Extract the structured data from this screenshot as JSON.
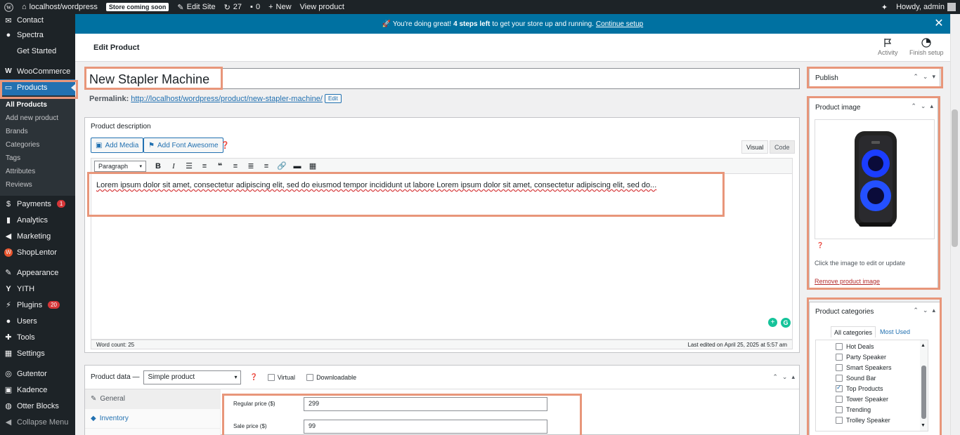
{
  "adminbar": {
    "site": "localhost/wordpress",
    "store_badge": "Store coming soon",
    "edit_site": "Edit Site",
    "updates": "27",
    "comments": "0",
    "new": "New",
    "view_product": "View product",
    "howdy": "Howdy, admin"
  },
  "sidebar": {
    "items_top": [
      {
        "label": "Contact",
        "icon": "envelope-icon"
      },
      {
        "label": "Spectra",
        "icon": "spectra-icon"
      },
      {
        "label": "Get Started",
        "icon": ""
      }
    ],
    "woocommerce": "WooCommerce",
    "products": "Products",
    "submenu": [
      "All Products",
      "Add new product",
      "Brands",
      "Categories",
      "Tags",
      "Attributes",
      "Reviews"
    ],
    "items_bottom": [
      {
        "label": "Payments",
        "icon": "payments-icon",
        "count": "1"
      },
      {
        "label": "Analytics",
        "icon": "analytics-icon"
      },
      {
        "label": "Marketing",
        "icon": "megaphone-icon"
      },
      {
        "label": "ShopLentor",
        "icon": "shoplentor-icon"
      },
      {
        "label": "Appearance",
        "icon": "brush-icon"
      },
      {
        "label": "YITH",
        "icon": "yith-icon"
      },
      {
        "label": "Plugins",
        "icon": "plug-icon",
        "count": "20"
      },
      {
        "label": "Users",
        "icon": "user-icon"
      },
      {
        "label": "Tools",
        "icon": "wrench-icon"
      },
      {
        "label": "Settings",
        "icon": "settings-icon"
      },
      {
        "label": "Gutentor",
        "icon": "gutentor-icon"
      },
      {
        "label": "Kadence",
        "icon": "kadence-icon"
      },
      {
        "label": "Otter Blocks",
        "icon": "otter-icon"
      },
      {
        "label": "Collapse Menu",
        "icon": "collapse-icon"
      }
    ]
  },
  "notice": {
    "lead": "🚀 You're doing great! ",
    "bold": "4 steps left",
    "rest": " to get your store up and running.",
    "link": "Continue setup"
  },
  "header": {
    "title": "Edit Product",
    "activity": "Activity",
    "finish_setup": "Finish setup"
  },
  "product": {
    "title": "New Stapler Machine",
    "permalink_label": "Permalink:",
    "permalink_url": "http://localhost/wordpress/product/new-stapler-machine/",
    "edit_btn": "Edit"
  },
  "description": {
    "heading": "Product description",
    "add_media": "Add Media",
    "add_font_awesome": "Add Font Awesome",
    "visual_tab": "Visual",
    "code_tab": "Code",
    "format_select": "Paragraph",
    "content": "Lorem ipsum dolor sit amet, consectetur adipiscing elit, sed do eiusmod tempor incididunt ut labore Lorem ipsum dolor sit amet, consectetur adipiscing elit, sed do...",
    "word_count": "Word count: 25",
    "last_edited": "Last edited on April 25, 2025 at 5:57 am"
  },
  "product_data": {
    "label": "Product data —",
    "type": "Simple product",
    "virtual": "Virtual",
    "downloadable": "Downloadable",
    "tabs": [
      "General",
      "Inventory"
    ],
    "regular_price_label": "Regular price ($)",
    "regular_price": "299",
    "sale_price_label": "Sale price ($)",
    "sale_price": "99"
  },
  "publish": {
    "title": "Publish"
  },
  "product_image": {
    "title": "Product image",
    "hint": "Click the image to edit or update",
    "remove": "Remove product image"
  },
  "categories": {
    "title": "Product categories",
    "tab_all": "All categories",
    "tab_most": "Most Used",
    "items": [
      {
        "label": "Hot Deals",
        "checked": false
      },
      {
        "label": "Party Speaker",
        "checked": false
      },
      {
        "label": "Smart Speakers",
        "checked": false
      },
      {
        "label": "Sound Bar",
        "checked": false
      },
      {
        "label": "Top Products",
        "checked": true
      },
      {
        "label": "Tower Speaker",
        "checked": false
      },
      {
        "label": "Trending",
        "checked": false
      },
      {
        "label": "Trolley Speaker",
        "checked": false
      }
    ]
  },
  "colors": {
    "accent": "#2271b1",
    "highlight": "#e8967a",
    "adminbar": "#1d2327",
    "notice": "#0071a1"
  }
}
